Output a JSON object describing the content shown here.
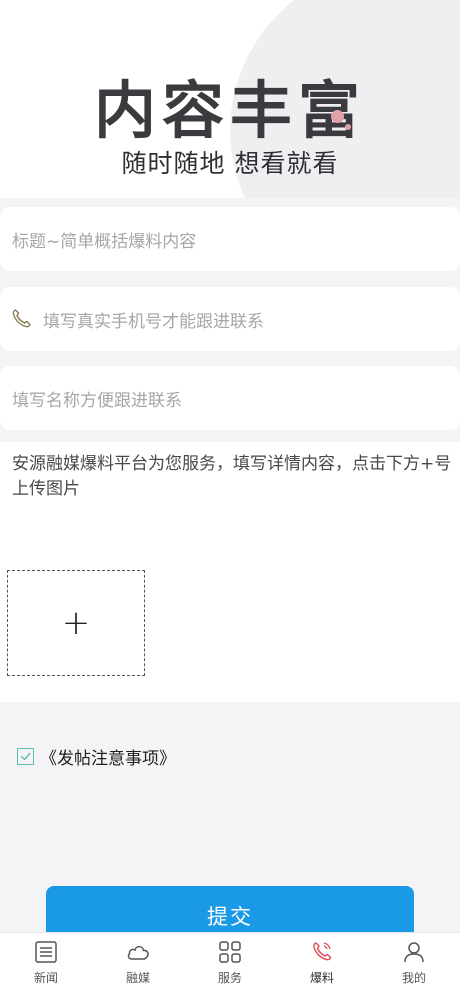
{
  "hero": {
    "title": "内容丰富",
    "subtitle": "随时随地 想看就看"
  },
  "form": {
    "title_placeholder": "标题~简单概括爆料内容",
    "phone_placeholder": "填写真实手机号才能跟进联系",
    "name_placeholder": "填写名称方便跟进联系",
    "content_placeholder": "安源融媒爆料平台为您服务，填写详情内容，点击下方+号上传图片",
    "upload_symbol": "+",
    "agreement_label": "《发帖注意事项》",
    "submit_label": "提交"
  },
  "tabbar": {
    "items": [
      {
        "label": "新闻",
        "icon": "list-icon"
      },
      {
        "label": "融媒",
        "icon": "cloud-icon"
      },
      {
        "label": "服务",
        "icon": "grid-icon"
      },
      {
        "label": "爆料",
        "icon": "phone-icon",
        "active": true
      },
      {
        "label": "我的",
        "icon": "person-icon"
      }
    ]
  },
  "colors": {
    "accent": "#1a9ae6",
    "active_tab": "#e0505a",
    "check": "#5bc0a8"
  }
}
